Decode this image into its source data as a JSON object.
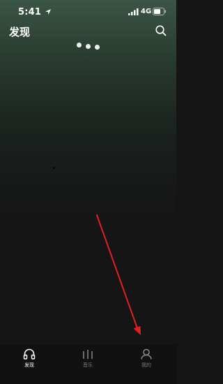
{
  "status_bar": {
    "time": "5:41",
    "network": "4G",
    "location_icon": "location-arrow-icon",
    "signal_icon": "cellular-signal-icon",
    "battery_icon": "battery-icon"
  },
  "header": {
    "title": "发现",
    "search_icon": "search-icon"
  },
  "carousel": {
    "page_count": 3
  },
  "tabs": [
    {
      "label": "发现",
      "icon": "headphones-icon",
      "active": true
    },
    {
      "label": "音乐",
      "icon": "music-bars-icon",
      "active": false
    },
    {
      "label": "我的",
      "icon": "person-icon",
      "active": false
    }
  ],
  "colors": {
    "annotation": "#e0211d",
    "active_text": "#ffffff",
    "inactive_text": "#7a7a7a",
    "background": "#151515",
    "header_tint": "#3b5546"
  }
}
